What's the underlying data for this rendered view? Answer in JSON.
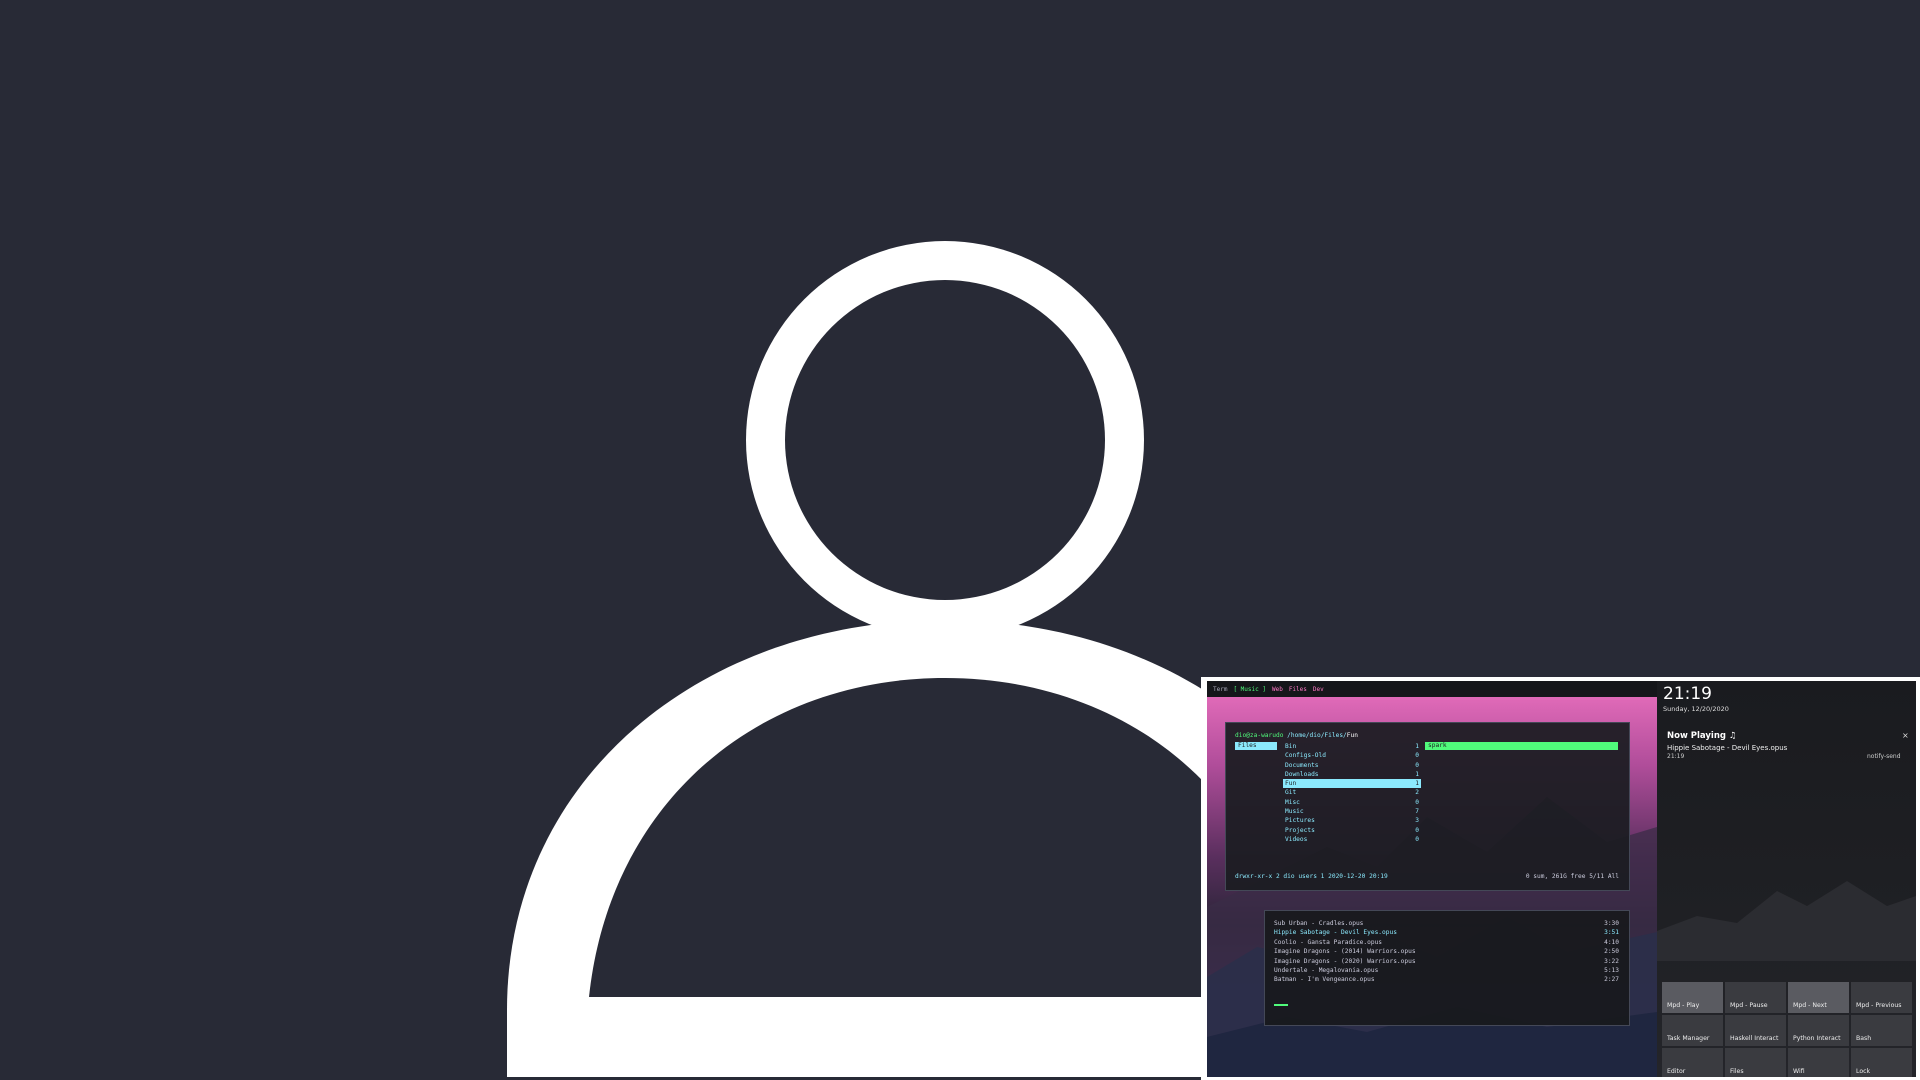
{
  "desktop": {
    "workspaces": [
      "Term",
      "[ Music ]",
      "Web",
      "Files",
      "Dev"
    ],
    "file_manager": {
      "user_host": "dio@za-warudo",
      "path": "/home/dio/Files/",
      "path_leaf": "Fun",
      "left_pane": "Files",
      "entries": [
        {
          "name": "Bin",
          "count": "1"
        },
        {
          "name": "Configs-Old",
          "count": "0"
        },
        {
          "name": "Documents",
          "count": "0"
        },
        {
          "name": "Downloads",
          "count": "1"
        },
        {
          "name": "Fun",
          "count": "1"
        },
        {
          "name": "Git",
          "count": "2"
        },
        {
          "name": "Misc",
          "count": "0"
        },
        {
          "name": "Music",
          "count": "7"
        },
        {
          "name": "Pictures",
          "count": "3"
        },
        {
          "name": "Projects",
          "count": "0"
        },
        {
          "name": "Videos",
          "count": "0"
        }
      ],
      "preview": "spark",
      "status_left": "drwxr-xr-x 2 dio users 1 2020-12-20 20:19",
      "status_right": "0 sum, 261G free  5/11  All"
    },
    "music_player": {
      "tracks": [
        {
          "title": "Sub Urban - Cradles.opus",
          "length": "3:30"
        },
        {
          "title": "Hippie Sabotage - Devil Eyes.opus",
          "length": "3:51"
        },
        {
          "title": "Coolio - Gansta Paradice.opus",
          "length": "4:10"
        },
        {
          "title": "Imagine Dragons - (2014) Warriors.opus",
          "length": "2:50"
        },
        {
          "title": "Imagine Dragons - (2020) Warriors.opus",
          "length": "3:22"
        },
        {
          "title": "Undertale - Megalovania.opus",
          "length": "5:13"
        },
        {
          "title": "Batman - I'm Vengeance.opus",
          "length": "2:27"
        }
      ]
    },
    "panel": {
      "clock": "21:19",
      "date": "Sunday, 12/20/2020",
      "notification": {
        "title": "Now Playing ♫",
        "close": "×",
        "body": "Hippie Sabotage - Devil Eyes.opus",
        "time": "21:19",
        "app": "notify-send"
      },
      "actions": [
        "Mpd - Play",
        "Mpd - Pause",
        "Mpd - Next",
        "Mpd - Previous",
        "Task Manager",
        "Haskell Interact",
        "Python Interact",
        "Bash",
        "Editor",
        "Files",
        "Wifi",
        "Lock"
      ]
    }
  },
  "colors": {
    "background": "#282a36",
    "avatar": "#ffffff",
    "accent_cyan": "#8be9fd",
    "accent_green": "#50fa7b",
    "accent_pink": "#ff79c6"
  }
}
